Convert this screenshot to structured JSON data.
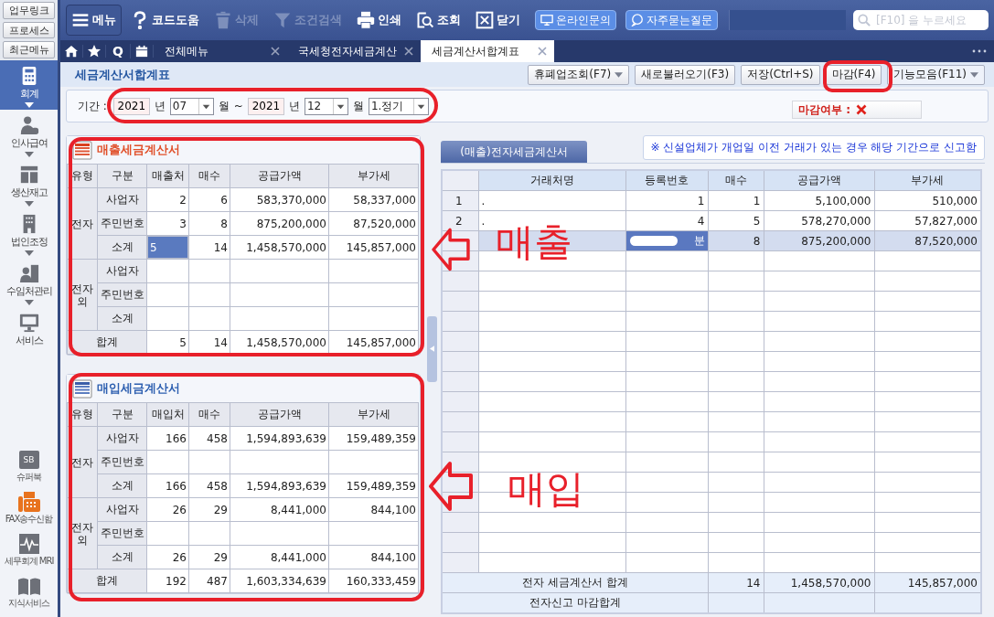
{
  "sidebar": {
    "top_links": [
      "업무링크",
      "프로세스",
      "최근메뉴"
    ],
    "modules": [
      {
        "label": "회계",
        "selected": true,
        "expandable": true
      },
      {
        "label": "인사급여",
        "selected": false,
        "expandable": true
      },
      {
        "label": "생산재고",
        "selected": false,
        "expandable": true
      },
      {
        "label": "법인조정",
        "selected": false,
        "expandable": true
      },
      {
        "label": "수임처관리",
        "selected": false,
        "expandable": true
      },
      {
        "label": "서비스",
        "selected": false,
        "expandable": false
      }
    ],
    "tools": [
      {
        "label": "슈퍼북",
        "icon_text": "SB"
      },
      {
        "label": "FAX송수신함"
      },
      {
        "label": "세무회계 MRI"
      },
      {
        "label": "지식서비스"
      }
    ]
  },
  "toolbar": {
    "items": [
      {
        "label": "메뉴",
        "disabled": false
      },
      {
        "label": "코드도움",
        "disabled": false
      },
      {
        "label": "삭제",
        "disabled": true
      },
      {
        "label": "조건검색",
        "disabled": true
      },
      {
        "label": "인쇄",
        "disabled": false
      },
      {
        "label": "조회",
        "disabled": false
      },
      {
        "label": "닫기",
        "disabled": false
      }
    ],
    "help_buttons": [
      "온라인문의",
      "자주묻는질문"
    ],
    "search": {
      "placeholder": "[F10] 을 누르세요"
    }
  },
  "tabbar": {
    "quick_label": "Q",
    "tabs": [
      {
        "label": "전체메뉴",
        "selected": false
      },
      {
        "label": "국세청전자세금계산",
        "selected": false
      },
      {
        "label": "세금계산서합계표",
        "selected": true
      }
    ]
  },
  "page": {
    "title": "세금계산서합계표",
    "actions": [
      {
        "label": "휴폐업조회(F7)",
        "dropdown": true
      },
      {
        "label": "새로불러오기(F3)",
        "dropdown": false
      },
      {
        "label": "저장(Ctrl+S)",
        "dropdown": false
      },
      {
        "label": "마감(F4)",
        "dropdown": false
      },
      {
        "label": "기능모음(F11)",
        "dropdown": true
      }
    ]
  },
  "filter": {
    "label": "기간 :",
    "from_year": "2021",
    "from_year_unit": "년",
    "from_month": "07",
    "from_month_unit": "월",
    "separator": "~",
    "to_year": "2021",
    "to_year_unit": "년",
    "to_month": "12",
    "to_month_unit": "월",
    "period_type": "1.정기",
    "closing_label": "마감여부 :",
    "closed": false
  },
  "sales": {
    "title": "매출세금계산서",
    "columns": [
      "유형",
      "구분",
      "매출처",
      "매수",
      "공급가액",
      "부가세"
    ],
    "groups": [
      {
        "label": "전자",
        "rows": [
          {
            "label": "사업자",
            "cells": [
              {
                "text": "2",
                "selected": false
              },
              {
                "text": "6",
                "selected": false
              },
              {
                "text": "583,370,000",
                "selected": false
              },
              {
                "text": "58,337,000",
                "selected": false
              }
            ]
          },
          {
            "label": "주민번호",
            "cells": [
              {
                "text": "3",
                "selected": false
              },
              {
                "text": "8",
                "selected": false
              },
              {
                "text": "875,200,000",
                "selected": false
              },
              {
                "text": "87,520,000",
                "selected": false
              }
            ]
          },
          {
            "label": "소계",
            "cells": [
              {
                "text": "5",
                "selected": true
              },
              {
                "text": "14",
                "selected": false
              },
              {
                "text": "1,458,570,000",
                "selected": false
              },
              {
                "text": "145,857,000",
                "selected": false
              }
            ]
          }
        ]
      },
      {
        "label": "전자외",
        "rows": [
          {
            "label": "사업자"
          },
          {
            "label": "주민번호"
          },
          {
            "label": "소계"
          }
        ]
      }
    ],
    "total": {
      "label": "합계",
      "cells": [
        {
          "text": "5",
          "selected": false
        },
        {
          "text": "14",
          "selected": false
        },
        {
          "text": "1,458,570,000",
          "selected": false
        },
        {
          "text": "145,857,000",
          "selected": false
        }
      ]
    }
  },
  "purchases": {
    "title": "매입세금계산서",
    "columns": [
      "유형",
      "구분",
      "매입처",
      "매수",
      "공급가액",
      "부가세"
    ],
    "groups": [
      {
        "label": "전자",
        "rows": [
          {
            "label": "사업자",
            "cells": [
              {
                "text": "166",
                "selected": false
              },
              {
                "text": "458",
                "selected": false
              },
              {
                "text": "1,594,893,639",
                "selected": false
              },
              {
                "text": "159,489,359",
                "selected": false
              }
            ]
          },
          {
            "label": "주민번호"
          },
          {
            "label": "소계",
            "cells": [
              {
                "text": "166",
                "selected": false
              },
              {
                "text": "458",
                "selected": false
              },
              {
                "text": "1,594,893,639",
                "selected": false
              },
              {
                "text": "159,489,359",
                "selected": false
              }
            ]
          }
        ]
      },
      {
        "label": "전자외",
        "rows": [
          {
            "label": "사업자",
            "cells": [
              {
                "text": "26",
                "selected": false
              },
              {
                "text": "29",
                "selected": false
              },
              {
                "text": "8,441,000",
                "selected": false
              },
              {
                "text": "844,100",
                "selected": false
              }
            ]
          },
          {
            "label": "주민번호"
          },
          {
            "label": "소계",
            "cells": [
              {
                "text": "26",
                "selected": false
              },
              {
                "text": "29",
                "selected": false
              },
              {
                "text": "8,441,000",
                "selected": false
              },
              {
                "text": "844,100",
                "selected": false
              }
            ]
          }
        ]
      }
    ],
    "total": {
      "label": "합계",
      "cells": [
        {
          "text": "192",
          "selected": false
        },
        {
          "text": "487",
          "selected": false
        },
        {
          "text": "1,603,334,639",
          "selected": false
        },
        {
          "text": "160,333,459",
          "selected": false
        }
      ]
    }
  },
  "detail": {
    "tab": "(매출)전자세금계산서",
    "note": "※ 신설업체가 개업일 이전 거래가 있는 경우 해당 기간으로 신고함",
    "columns": [
      "거래처명",
      "등록번호",
      "매수",
      "공급가액",
      "부가세"
    ],
    "rows": [
      {
        "no": "1",
        "name": ".",
        "reg": "1",
        "count": "1",
        "supply": "5,100,000",
        "vat": "510,000",
        "selected": false,
        "redacted": false
      },
      {
        "no": "2",
        "name": ".",
        "reg": "4",
        "count": "5",
        "supply": "578,270,000",
        "vat": "57,827,000",
        "selected": false,
        "redacted": false
      },
      {
        "reg": "분",
        "count": "8",
        "supply": "875,200,000",
        "vat": "87,520,000",
        "selected": true,
        "redacted": true
      }
    ],
    "footer": [
      {
        "label": "전자 세금계산서 합계",
        "count": "14",
        "supply": "1,458,570,000",
        "vat": "145,857,000"
      },
      {
        "label": "전자신고 마감합계"
      }
    ]
  },
  "annotations": {
    "sales_label": "매출",
    "purchase_label": "매입"
  }
}
